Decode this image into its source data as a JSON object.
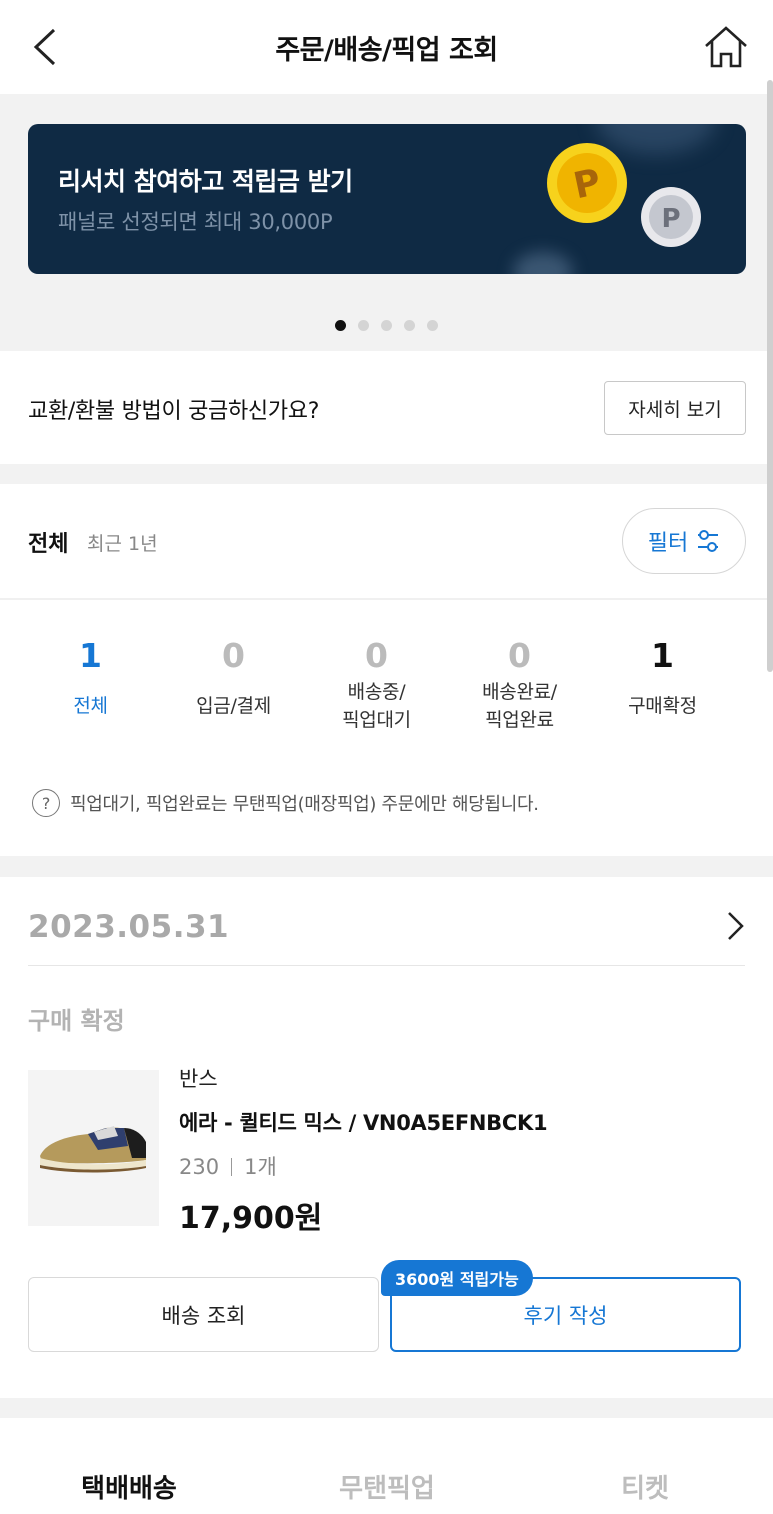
{
  "header": {
    "title": "주문/배송/픽업 조회",
    "back_icon": "back-arrow-icon",
    "home_icon": "home-icon"
  },
  "banner": {
    "title": "리서치 참여하고 적립금 받기",
    "subtitle": "패널로 선정되면 최대 30,000P",
    "coin_label": "P",
    "background": "#0f2a44",
    "page_count": 5,
    "active_page": 1
  },
  "exchange": {
    "question": "교환/환불 방법이 궁금하신가요?",
    "detail_label": "자세히 보기"
  },
  "filter": {
    "scope": "전체",
    "period": "최근 1년",
    "filter_label": "필터"
  },
  "stats": [
    {
      "count": "1",
      "label": "전체"
    },
    {
      "count": "0",
      "label": "입금/결제"
    },
    {
      "count": "0",
      "label_line1": "배송중/",
      "label_line2": "픽업대기"
    },
    {
      "count": "0",
      "label_line1": "배송완료/",
      "label_line2": "픽업완료"
    },
    {
      "count": "1",
      "label": "구매확정"
    }
  ],
  "notice": {
    "icon": "?",
    "text": "픽업대기, 픽업완료는 무탠픽업(매장픽업) 주문에만 해당됩니다."
  },
  "order": {
    "date": "2023.05.31",
    "status": "구매 확정",
    "brand": "반스",
    "product_name": "에라 - 퀼티드 믹스 / VN0A5EFNBCK1",
    "size": "230",
    "quantity": "1개",
    "price": "17,900원",
    "track_label": "배송 조회",
    "review_label": "후기 작성",
    "reward_badge": "3600원 적립가능"
  },
  "tabs": [
    {
      "label": "택배배송",
      "active": true
    },
    {
      "label": "무탠픽업",
      "active": false
    },
    {
      "label": "티켓",
      "active": false
    }
  ],
  "colors": {
    "accent": "#1677d4",
    "banner": "#0f2a44"
  }
}
